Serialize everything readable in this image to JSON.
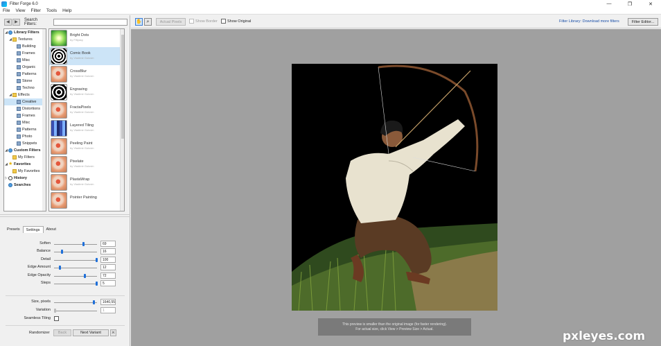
{
  "window": {
    "title": "Filter Forge 6.0",
    "minimize": "—",
    "maximize": "❐",
    "close": "✕"
  },
  "menu": [
    "File",
    "View",
    "Filter",
    "Tools",
    "Help"
  ],
  "search": {
    "label": "Search Filters:",
    "value": "",
    "back": "◀",
    "forward": "▶"
  },
  "tree": [
    {
      "label": "Library Filters",
      "icon": "library",
      "twist": "◢",
      "indent": 0,
      "bold": true,
      "selected": false
    },
    {
      "label": "Textures",
      "icon": "folder",
      "twist": "◢",
      "indent": 1,
      "bold": false,
      "selected": false
    },
    {
      "label": "Building",
      "icon": "page",
      "twist": "",
      "indent": 2,
      "bold": false,
      "selected": false
    },
    {
      "label": "Frames",
      "icon": "page",
      "twist": "",
      "indent": 2,
      "bold": false,
      "selected": false
    },
    {
      "label": "Misc",
      "icon": "page",
      "twist": "",
      "indent": 2,
      "bold": false,
      "selected": false
    },
    {
      "label": "Organic",
      "icon": "page",
      "twist": "",
      "indent": 2,
      "bold": false,
      "selected": false
    },
    {
      "label": "Patterns",
      "icon": "page",
      "twist": "",
      "indent": 2,
      "bold": false,
      "selected": false
    },
    {
      "label": "Stone",
      "icon": "page",
      "twist": "",
      "indent": 2,
      "bold": false,
      "selected": false
    },
    {
      "label": "Techno",
      "icon": "page",
      "twist": "",
      "indent": 2,
      "bold": false,
      "selected": false
    },
    {
      "label": "Effects",
      "icon": "folder",
      "twist": "◢",
      "indent": 1,
      "bold": false,
      "selected": false
    },
    {
      "label": "Creative",
      "icon": "page",
      "twist": "",
      "indent": 2,
      "bold": false,
      "selected": true
    },
    {
      "label": "Distortions",
      "icon": "page",
      "twist": "",
      "indent": 2,
      "bold": false,
      "selected": false
    },
    {
      "label": "Frames",
      "icon": "page",
      "twist": "",
      "indent": 2,
      "bold": false,
      "selected": false
    },
    {
      "label": "Misc",
      "icon": "page",
      "twist": "",
      "indent": 2,
      "bold": false,
      "selected": false
    },
    {
      "label": "Patterns",
      "icon": "page",
      "twist": "",
      "indent": 2,
      "bold": false,
      "selected": false
    },
    {
      "label": "Photo",
      "icon": "page",
      "twist": "",
      "indent": 2,
      "bold": false,
      "selected": false
    },
    {
      "label": "Snippets",
      "icon": "page",
      "twist": "",
      "indent": 2,
      "bold": false,
      "selected": false
    },
    {
      "label": "Custom Filters",
      "icon": "library",
      "twist": "◢",
      "indent": 0,
      "bold": true,
      "selected": false
    },
    {
      "label": "My Filters",
      "icon": "folder",
      "twist": "",
      "indent": 1,
      "bold": false,
      "selected": false
    },
    {
      "label": "Favorites",
      "icon": "star",
      "twist": "◢",
      "indent": 0,
      "bold": true,
      "selected": false
    },
    {
      "label": "My Favorites",
      "icon": "folder",
      "twist": "",
      "indent": 1,
      "bold": false,
      "selected": false
    },
    {
      "label": "History",
      "icon": "history",
      "twist": "▷",
      "indent": 0,
      "bold": true,
      "selected": false
    },
    {
      "label": "Searches",
      "icon": "search",
      "twist": "",
      "indent": 0,
      "bold": true,
      "selected": false
    }
  ],
  "filters": [
    {
      "name": "Bright Dots",
      "author": "by Fiftysky",
      "selected": false
    },
    {
      "name": "Comic Book",
      "author": "by Vladimir Golovin",
      "selected": true
    },
    {
      "name": "CrossBlur",
      "author": "by Vladimir Golovin",
      "selected": false
    },
    {
      "name": "Engraving",
      "author": "by Vladimir Golovin",
      "selected": false
    },
    {
      "name": "FractaPixels",
      "author": "by Vladimir Golovin",
      "selected": false
    },
    {
      "name": "Layered Tiling",
      "author": "by Vladimir Golovin",
      "selected": false
    },
    {
      "name": "Peeling Paint",
      "author": "by Vladimir Golovin",
      "selected": false
    },
    {
      "name": "Pixelate",
      "author": "by Vladimir Golovin",
      "selected": false
    },
    {
      "name": "PlastaWrap",
      "author": "by Vladimir Golovin",
      "selected": false
    },
    {
      "name": "Pointer Painting",
      "author": "",
      "selected": false
    }
  ],
  "tabs": [
    {
      "label": "Presets",
      "active": false
    },
    {
      "label": "Settings",
      "active": true
    },
    {
      "label": "About",
      "active": false
    }
  ],
  "settings": {
    "sliders": [
      {
        "label": "Soften",
        "value": "69",
        "fraction": 0.69
      },
      {
        "label": "Balance",
        "value": "16",
        "fraction": 0.16
      },
      {
        "label": "Detail",
        "value": "100",
        "fraction": 1.0
      },
      {
        "label": "Edge Amount",
        "value": "12",
        "fraction": 0.12
      },
      {
        "label": "Edge Opacity",
        "value": "72",
        "fraction": 0.72
      },
      {
        "label": "Steps",
        "value": "5",
        "fraction": 1.0
      }
    ],
    "size": {
      "label": "Size, pixels",
      "value": "1640,55",
      "fraction": 0.93
    },
    "variation": {
      "label": "Variation",
      "value": "1",
      "fraction": 0.0
    },
    "seamless": {
      "label": "Seamless Tiling",
      "checked": false
    }
  },
  "randomizer": {
    "label": "Randomizer",
    "back": "Back",
    "next": "Next Variant",
    "icon": "⚔"
  },
  "toolbar": {
    "hand": "✋",
    "zoom": "⌕",
    "actual_pixels": "Actual Pixels",
    "show_border": "Show Border",
    "show_original": "Show Original",
    "library_link": "Filter Library: Download more filters",
    "filter_editor": "Filter Editor..."
  },
  "preview": {
    "status_line1": "This preview is smaller than the original image (for faster rendering).",
    "status_line2": "For actual size, click View > Preview Size > Actual."
  },
  "watermark": "pxleyes.com"
}
